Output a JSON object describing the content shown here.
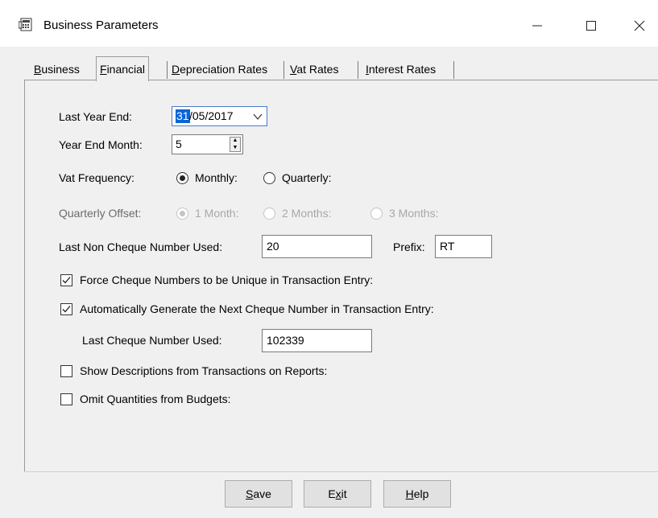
{
  "window": {
    "title": "Business Parameters",
    "icon": "app-icon",
    "controls": [
      "minimize-icon",
      "maximize-icon",
      "close-icon"
    ]
  },
  "tabs": [
    {
      "label_prefix": "",
      "label_hot": "B",
      "label_rest": "usiness",
      "active": false
    },
    {
      "label_prefix": "",
      "label_hot": "F",
      "label_rest": "inancial",
      "active": true
    },
    {
      "label_prefix": "",
      "label_hot": "D",
      "label_rest": "epreciation Rates",
      "active": false
    },
    {
      "label_prefix": "",
      "label_hot": "V",
      "label_rest": "at Rates",
      "active": false
    },
    {
      "label_prefix": "",
      "label_hot": "I",
      "label_rest": "nterest Rates",
      "active": false
    }
  ],
  "fields": {
    "last_year_end_label": "Last Year End:",
    "last_year_end_day": "31",
    "last_year_end_rest": "/05/2017",
    "year_end_month_label": "Year End Month:",
    "year_end_month_value": "5",
    "vat_frequency_label": "Vat Frequency:",
    "vat_monthly_label": "Monthly:",
    "vat_quarterly_label": "Quarterly:",
    "vat_frequency_selected": "Monthly",
    "quarterly_offset_label": "Quarterly Offset:",
    "offset_1_label": "1 Month:",
    "offset_2_label": "2 Months:",
    "offset_3_label": "3 Months:",
    "last_non_cheque_label": "Last Non Cheque Number Used:",
    "last_non_cheque_value": "20",
    "prefix_label": "Prefix:",
    "prefix_value": "RT",
    "force_unique_label": "Force Cheque Numbers to be Unique in Transaction Entry:",
    "force_unique_checked": true,
    "auto_generate_label": "Automatically Generate the Next Cheque Number in Transaction Entry:",
    "auto_generate_checked": true,
    "last_cheque_label": "Last Cheque Number Used:",
    "last_cheque_value": "102339",
    "show_descriptions_label": "Show Descriptions from Transactions on Reports:",
    "show_descriptions_checked": false,
    "omit_quantities_label": "Omit Quantities from Budgets:",
    "omit_quantities_checked": false
  },
  "buttons": {
    "save_hot": "S",
    "save_rest": "ave",
    "exit_pre": "E",
    "exit_hot": "x",
    "exit_rest": "it",
    "help_hot": "H",
    "help_rest": "elp"
  }
}
